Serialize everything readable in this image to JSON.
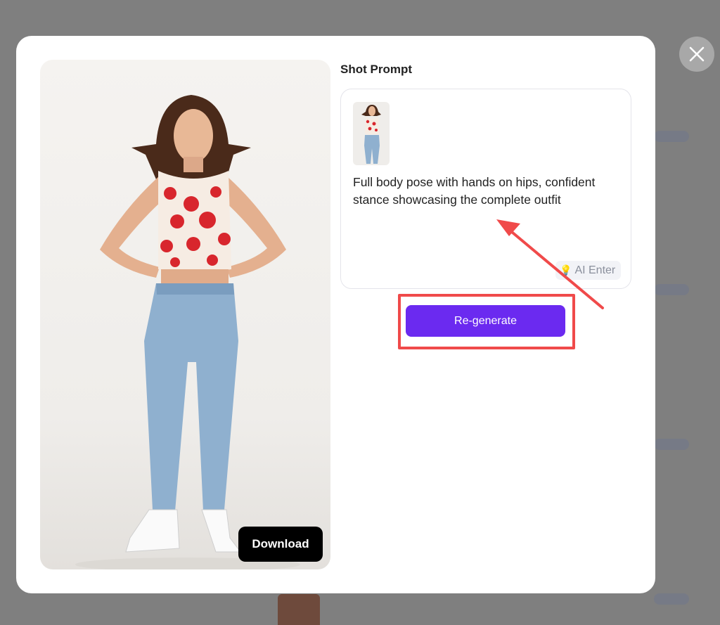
{
  "dialog": {
    "section_title": "Shot Prompt",
    "prompt_text": "Full body pose with hands on hips, confident stance showcasing the complete outfit",
    "ai_enter_label": "AI Enter",
    "ai_enter_icon": "lightbulb-icon",
    "regenerate_label": "Re-generate",
    "download_label": "Download",
    "close_icon": "close-icon"
  },
  "colors": {
    "accent": "#6b2af0",
    "highlight": "#f04a4a",
    "download_bg": "#000000"
  }
}
